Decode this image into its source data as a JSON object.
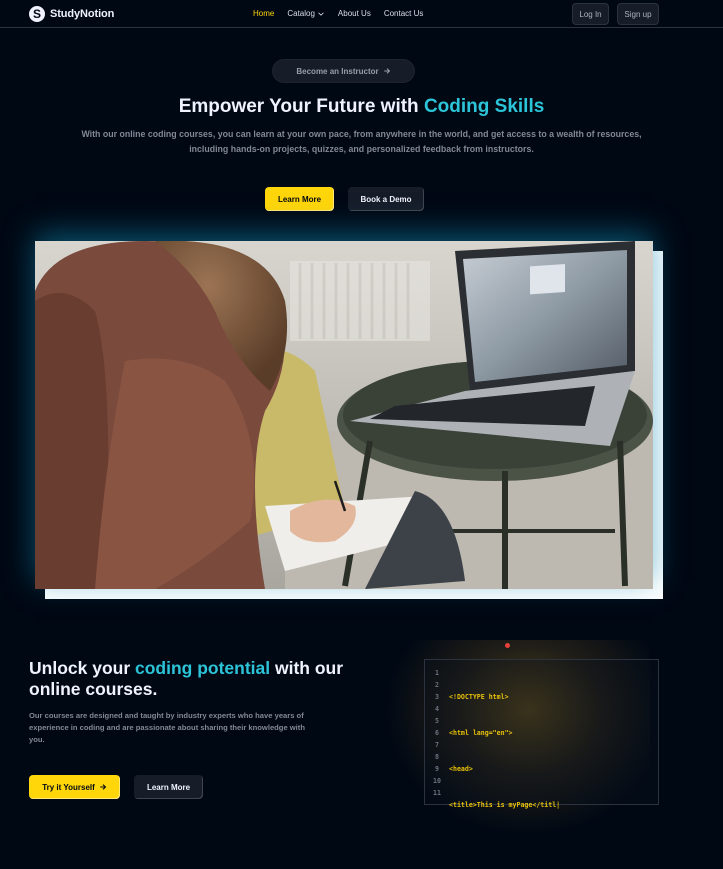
{
  "nav": {
    "logo_letter": "S",
    "brand": "StudyNotion",
    "links": [
      {
        "label": "Home",
        "active": true
      },
      {
        "label": "Catalog",
        "active": false
      },
      {
        "label": "About Us",
        "active": false
      },
      {
        "label": "Contact Us",
        "active": false
      }
    ],
    "catalog_icon": "chevron-down-icon",
    "login": "Log In",
    "signup": "Sign up"
  },
  "hero": {
    "instructor_button": "Become an Instructor",
    "instructor_icon": "arrow-right-icon",
    "title_prefix": "Empower Your Future with ",
    "title_highlight": "Coding Skills",
    "subtitle": "With our online coding courses, you can learn at your own pace, from anywhere in the world, and get access to a wealth of resources, including hands-on projects, quizzes, and personalized feedback from instructors.",
    "learn_more": "Learn More",
    "book_demo": "Book a Demo"
  },
  "section2": {
    "title_prefix": "Unlock your ",
    "title_highlight": "coding potential",
    "title_suffix": " with our online courses.",
    "description": "Our courses are designed and taught by industry experts who have years of experience in coding and are passionate about sharing their knowledge with you.",
    "try_button": "Try it Yourself",
    "try_icon": "arrow-right-icon",
    "learn_more": "Learn More",
    "code": {
      "line_numbers": [
        "1",
        "2",
        "3",
        "4",
        "5",
        "6",
        "7",
        "8",
        "9",
        "10",
        "11"
      ],
      "lines": [
        "<!DOCTYPE html>",
        "<html lang=\"en\">",
        "<head>",
        "<title>This is myPage</titl|"
      ]
    }
  },
  "colors": {
    "background": "#000814",
    "accent_yellow": "#FFD60A",
    "highlight_blue": "#2CC4D8",
    "code_yellow": "#E7C009"
  }
}
